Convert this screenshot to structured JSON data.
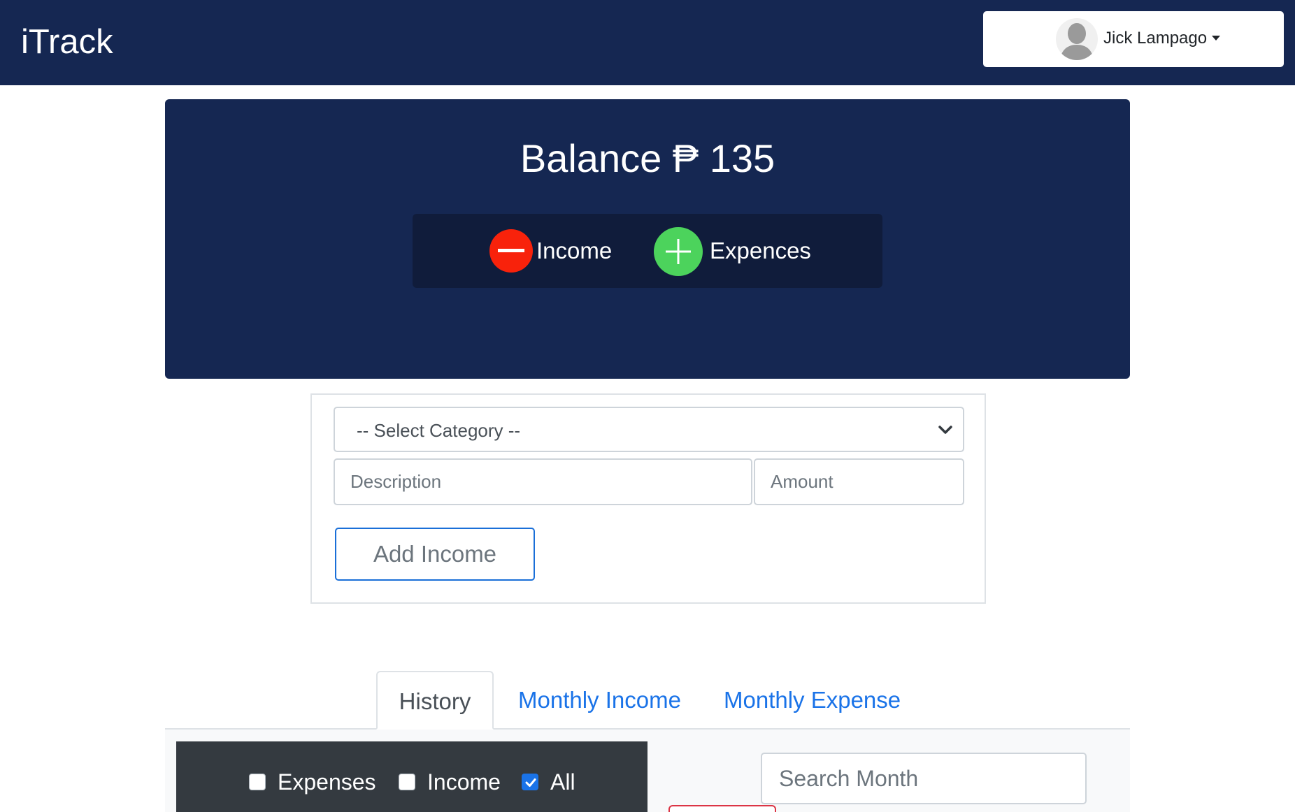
{
  "navbar": {
    "brand": "iTrack",
    "user_name": "Jick Lampago",
    "bg_color": "#152752"
  },
  "balance": {
    "label": "Balance ₱ 135",
    "toggle_income_label": "Income",
    "toggle_expense_label": "Expences",
    "income_icon": "minus-circle-icon",
    "expense_icon": "plus-circle-icon",
    "income_icon_color": "#f8220b",
    "expense_icon_color": "#4cd35c"
  },
  "form": {
    "category_selected": "-- Select Category --",
    "description_placeholder": "Description",
    "amount_placeholder": "Amount",
    "submit_label": "Add Income"
  },
  "tabs": [
    {
      "label": "History",
      "active": true
    },
    {
      "label": "Monthly Income",
      "active": false
    },
    {
      "label": "Monthly Expense",
      "active": false
    }
  ],
  "filters": {
    "expenses_label": "Expenses",
    "expenses_checked": false,
    "income_label": "Income",
    "income_checked": false,
    "all_label": "All",
    "all_checked": true
  },
  "search": {
    "placeholder": "Search Month"
  }
}
